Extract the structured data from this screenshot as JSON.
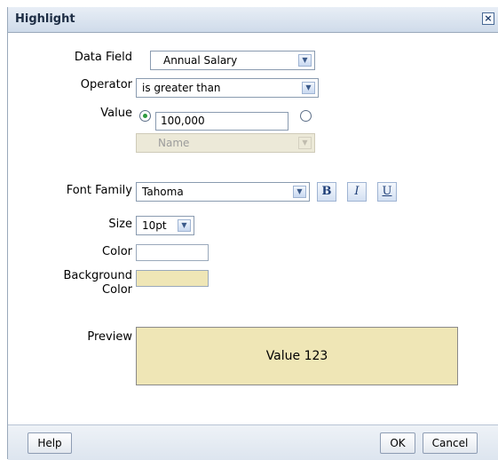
{
  "dialog": {
    "title": "Highlight",
    "close_symbol": "×"
  },
  "labels": {
    "data_field": "Data Field",
    "operator": "Operator",
    "value": "Value",
    "font_family": "Font Family",
    "size": "Size",
    "color": "Color",
    "background_color_line1": "Background",
    "background_color_line2": "Color",
    "preview": "Preview"
  },
  "data_field": {
    "selected": "Annual Salary"
  },
  "operator": {
    "selected": "is greater than"
  },
  "value": {
    "text": "100,000",
    "field_select": "Name"
  },
  "font": {
    "family": "Tahoma",
    "size": "10pt",
    "bold_label": "B",
    "italic_label": "I",
    "underline_label": "U"
  },
  "colors": {
    "text_color": "#ffffff",
    "background_color": "#efe6b6"
  },
  "preview": {
    "text": "Value 123"
  },
  "buttons": {
    "help": "Help",
    "ok": "OK",
    "cancel": "Cancel"
  },
  "icons": {
    "dropdown": "chevron-down-icon",
    "close": "close-icon"
  }
}
